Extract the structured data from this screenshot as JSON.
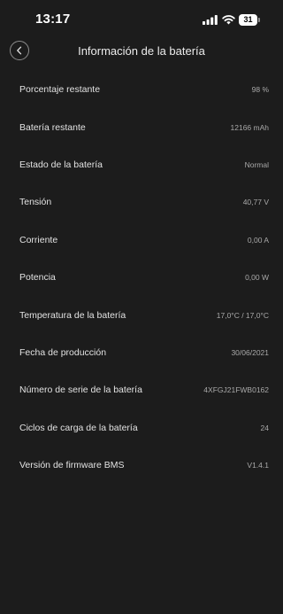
{
  "status_bar": {
    "time": "13:17",
    "battery_level": "31",
    "icons": [
      "signal-icon",
      "wifi-icon",
      "battery-icon"
    ]
  },
  "header": {
    "title": "Información de la batería",
    "back_icon": "chevron-left-icon"
  },
  "colors": {
    "background": "#1c1c1c",
    "label": "#e2e2e2",
    "value": "#a9a9a9"
  },
  "rows": [
    {
      "label": "Porcentaje restante",
      "value": "98 %"
    },
    {
      "label": "Batería restante",
      "value": "12166 mAh"
    },
    {
      "label": "Estado de la batería",
      "value": "Normal"
    },
    {
      "label": "Tensión",
      "value": "40,77 V"
    },
    {
      "label": "Corriente",
      "value": "0,00 A"
    },
    {
      "label": "Potencia",
      "value": "0,00 W"
    },
    {
      "label": "Temperatura de la batería",
      "value": "17,0°C / 17,0°C"
    },
    {
      "label": "Fecha de producción",
      "value": "30/06/2021"
    },
    {
      "label": "Número de serie de la batería",
      "value": "4XFGJ21FWB0162"
    },
    {
      "label": "Ciclos de carga de la batería",
      "value": "24"
    },
    {
      "label": "Versión de firmware BMS",
      "value": "V1.4.1"
    }
  ]
}
